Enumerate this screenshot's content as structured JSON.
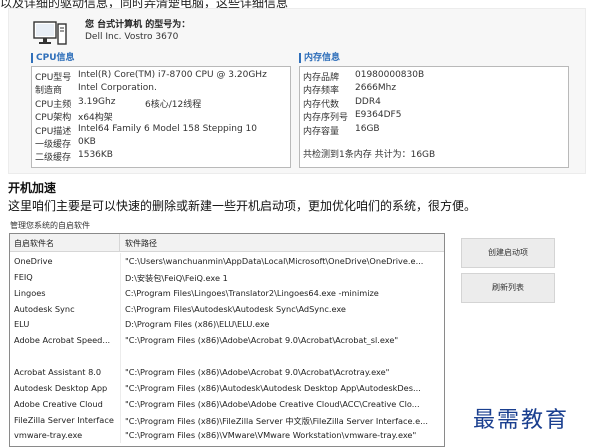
{
  "top_text": "以及详细的驱动信息，同时弄清楚电脑，这些详细信息",
  "computer": {
    "title": "您 台式计算机 的型号为：",
    "model": "Dell Inc. Vostro 3670",
    "icon": "desktop-computer-icon"
  },
  "cpu": {
    "title": "CPU信息",
    "rows": [
      {
        "k": "CPU型号",
        "v": "Intel(R) Core(TM) i7-8700 CPU @ 3.20GHz"
      },
      {
        "k": "制造商",
        "v": "Intel Corporation."
      },
      {
        "k": "CPU主频",
        "v": "3.19Ghz",
        "extra": "6核心/12线程"
      },
      {
        "k": "CPU架构",
        "v": "x64构架"
      },
      {
        "k": "CPU描述",
        "v": "Intel64 Family 6 Model 158 Stepping 10"
      },
      {
        "k": "一级缓存",
        "v": "0KB"
      },
      {
        "k": "二级缓存",
        "v": "1536KB"
      }
    ]
  },
  "memory": {
    "title": "内存信息",
    "rows": [
      {
        "k": "内存品牌",
        "v": "01980000830B"
      },
      {
        "k": "内存频率",
        "v": "2666Mhz"
      },
      {
        "k": "内存代数",
        "v": "DDR4"
      },
      {
        "k": "内存序列号",
        "v": "E9364DF5"
      },
      {
        "k": "内存容量",
        "v": "16GB"
      }
    ],
    "summary": "共检测到1条内存 共计为：16GB"
  },
  "section": {
    "title": "开机加速",
    "desc": "这里咱们主要是可以快速的删除或新建一些开机启动项，更加优化咱们的系统，很方便。"
  },
  "manager": {
    "label": "管理您系统的自启软件",
    "columns": [
      "自启软件名",
      "软件路径"
    ],
    "rows": [
      {
        "name": "OneDrive",
        "path": "\"C:\\Users\\wanchuanmin\\AppData\\Local\\Microsoft\\OneDrive\\OneDrive.e..."
      },
      {
        "name": "FEIQ",
        "path": "D:\\安装包\\FeiQ\\FeiQ.exe  1"
      },
      {
        "name": "Lingoes",
        "path": "C:\\Program Files\\Lingoes\\Translator2\\Lingoes64.exe -minimize"
      },
      {
        "name": "Autodesk Sync",
        "path": "C:\\Program Files\\Autodesk\\Autodesk Sync\\AdSync.exe"
      },
      {
        "name": "ELU",
        "path": "D:\\Program Files (x86)\\ELU\\ELU.exe"
      },
      {
        "name": "Adobe Acrobat Speed...",
        "path": "\"C:\\Program Files (x86)\\Adobe\\Acrobat 9.0\\Acrobat\\Acrobat_sl.exe\""
      },
      {
        "name": "",
        "path": ""
      },
      {
        "name": "Acrobat Assistant 8.0",
        "path": "\"C:\\Program Files (x86)\\Adobe\\Acrobat 9.0\\Acrobat\\Acrotray.exe\""
      },
      {
        "name": "Autodesk Desktop App",
        "path": "\"C:\\Program Files (x86)\\Autodesk\\Autodesk Desktop App\\AutodeskDes..."
      },
      {
        "name": "Adobe Creative Cloud",
        "path": "\"C:\\Program Files (x86)\\Adobe\\Adobe Creative Cloud\\ACC\\Creative Clo..."
      },
      {
        "name": "FileZilla Server Interface",
        "path": "\"C:\\Program Files (x86)\\FileZilla Server 中文版\\FileZilla Server Interface.e..."
      },
      {
        "name": "vmware-tray.exe",
        "path": "\"C:\\Program Files (x86)\\VMware\\VMware Workstation\\vmware-tray.exe\""
      }
    ],
    "buttons": {
      "create": "创建启动项",
      "refresh": "刷新列表"
    }
  },
  "watermark": "最需教育",
  "colors": {
    "accent": "#2f6fba",
    "watermark": "#1a3f8f"
  }
}
